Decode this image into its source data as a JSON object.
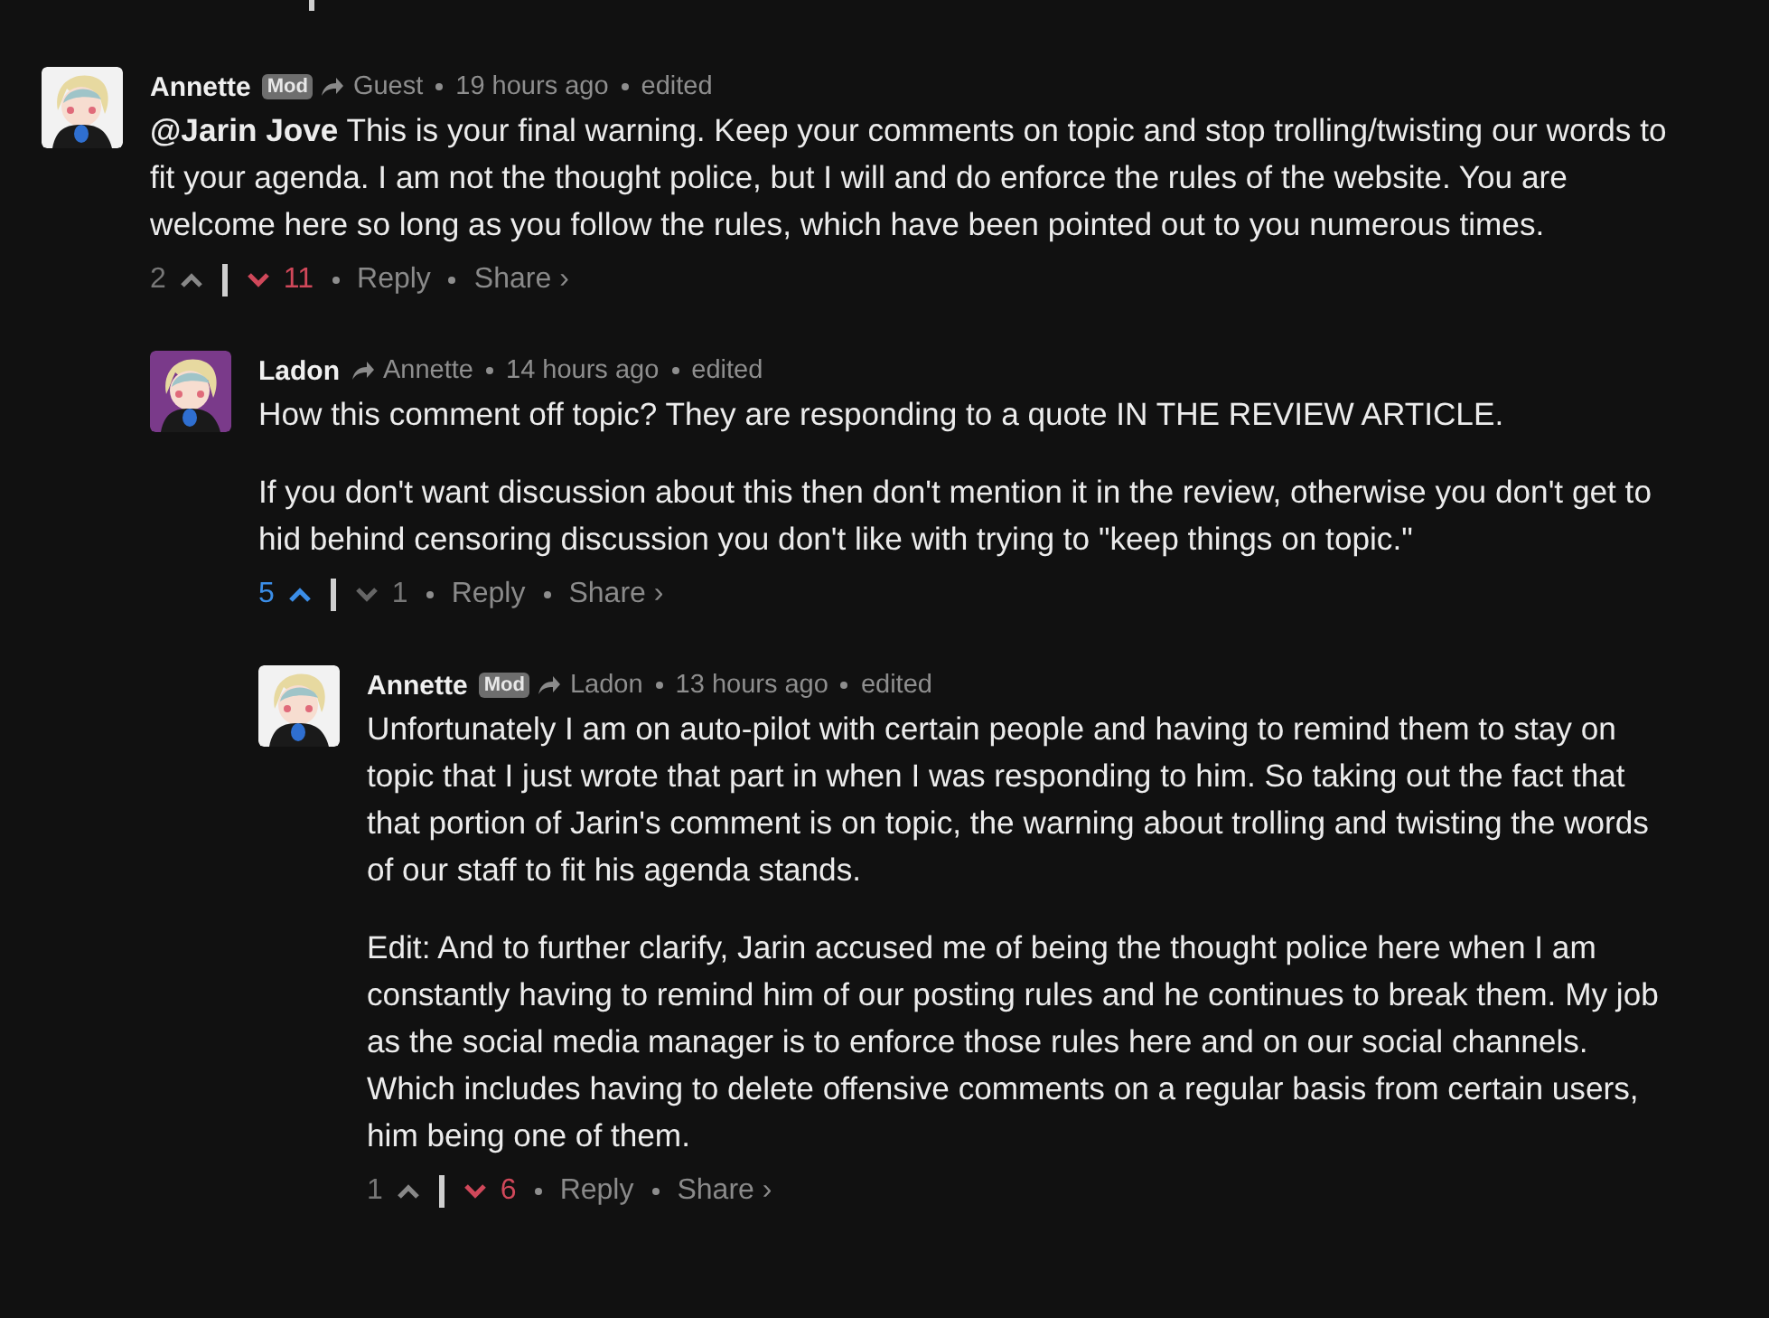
{
  "comments": [
    {
      "author": "Annette",
      "mod_badge": "Mod",
      "reply_to": "Guest",
      "time": "19 hours ago",
      "edited": "edited",
      "color": "#f2f2f2",
      "paragraphs": [
        "**@Jarin Jove** This is your final warning. Keep your comments on topic and stop trolling/twisting our words to fit your agenda. I am not the thought police, but I will and do enforce the rules of the website. You are welcome here so long as you follow the rules, which have been pointed out to you numerous times."
      ],
      "upvotes": "2",
      "downvotes": "11",
      "upvoted": false,
      "downvoted": true,
      "reply": "Reply",
      "share": "Share ›",
      "children": [
        {
          "author": "Ladon",
          "reply_to": "Annette",
          "time": "14 hours ago",
          "edited": "edited",
          "color": "#7a3a8a",
          "paragraphs": [
            "How this comment off topic? They are responding to a quote IN THE REVIEW ARTICLE.",
            "If you don't want discussion about this then don't mention it in the review, otherwise you don't get to hid behind censoring discussion you don't like with trying to \"keep things on topic.\""
          ],
          "upvotes": "5",
          "downvotes": "1",
          "upvoted": true,
          "downvoted": false,
          "reply": "Reply",
          "share": "Share ›",
          "children": [
            {
              "author": "Annette",
              "mod_badge": "Mod",
              "reply_to": "Ladon",
              "time": "13 hours ago",
              "edited": "edited",
              "color": "#f2f2f2",
              "paragraphs": [
                "Unfortunately I am on auto-pilot with certain people and having to remind them to stay on topic that I just wrote that part in when I was responding to him. So taking out the fact that that portion of Jarin's comment is on topic, the warning about trolling and twisting the words of our staff to fit his agenda stands.",
                "Edit: And to further clarify, Jarin accused me of being the thought police here when I am constantly having to remind him of our posting rules and he continues to break them. My job as the social media manager is to enforce those rules here and on our social channels. Which includes having to delete offensive comments on a regular basis from certain users, him being one of them."
              ],
              "upvotes": "1",
              "downvotes": "6",
              "upvoted": false,
              "downvoted": true,
              "reply": "Reply",
              "share": "Share ›"
            }
          ]
        }
      ]
    }
  ]
}
